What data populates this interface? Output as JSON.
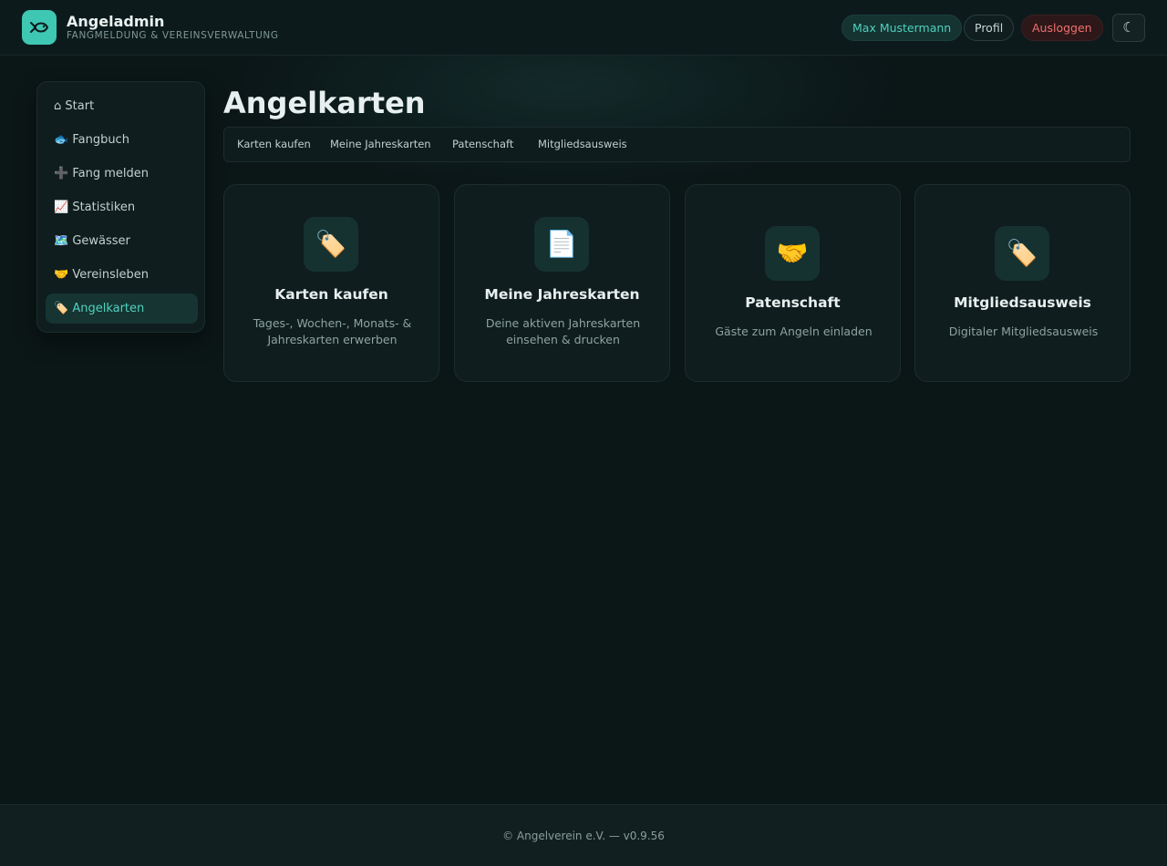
{
  "header": {
    "app_title": "Angeladmin",
    "app_subtitle": "FANGMELDUNG & VEREINSVERWALTUNG",
    "logo_icon": "fish-icon",
    "user_name": "Max Mustermann",
    "profile_label": "Profil",
    "logout_label": "Ausloggen",
    "theme_toggle_glyph": "☾",
    "theme_toggle_icon": "moon-icon"
  },
  "sidebar": {
    "items": [
      {
        "icon": "⌂",
        "label": "Start",
        "icon_name": "home-icon"
      },
      {
        "icon": "🐟",
        "label": "Fangbuch",
        "icon_name": "fish-icon"
      },
      {
        "icon": "➕",
        "label": "Fang melden",
        "icon_name": "plus-icon"
      },
      {
        "icon": "📈",
        "label": "Statistiken",
        "icon_name": "chart-icon"
      },
      {
        "icon": "🗺️",
        "label": "Gewässer",
        "icon_name": "map-icon"
      },
      {
        "icon": "🤝",
        "label": "Vereinsleben",
        "icon_name": "handshake-icon"
      },
      {
        "icon": "🏷️",
        "label": "Angelkarten",
        "icon_name": "tag-icon",
        "active": true
      }
    ]
  },
  "main": {
    "title": "Angelkarten",
    "tabs": [
      {
        "label": "Karten kaufen"
      },
      {
        "label": "Meine Jahreskarten"
      },
      {
        "label": "Patenschaft"
      },
      {
        "label": "Mitgliedsausweis"
      }
    ],
    "cards": [
      {
        "icon": "🏷️",
        "icon_name": "tag-icon",
        "title": "Karten kaufen",
        "desc": "Tages-, Wochen-, Monats- & Jahreskarten erwerben"
      },
      {
        "icon": "📄",
        "icon_name": "document-icon",
        "title": "Meine Jahreskarten",
        "desc": "Deine aktiven Jahreskarten einsehen & drucken"
      },
      {
        "icon": "🤝",
        "icon_name": "handshake-icon",
        "title": "Patenschaft",
        "desc": "Gäste zum Angeln einladen"
      },
      {
        "icon": "🏷️",
        "icon_name": "tag-icon",
        "title": "Mitgliedsausweis",
        "desc": "Digitaler Mitgliedsausweis"
      }
    ]
  },
  "footer": {
    "text": "© Angelverein e.V. — v0.9.56"
  },
  "colors": {
    "accent": "#3ec7b3",
    "background": "#0b1617",
    "danger": "#f06f6f"
  }
}
